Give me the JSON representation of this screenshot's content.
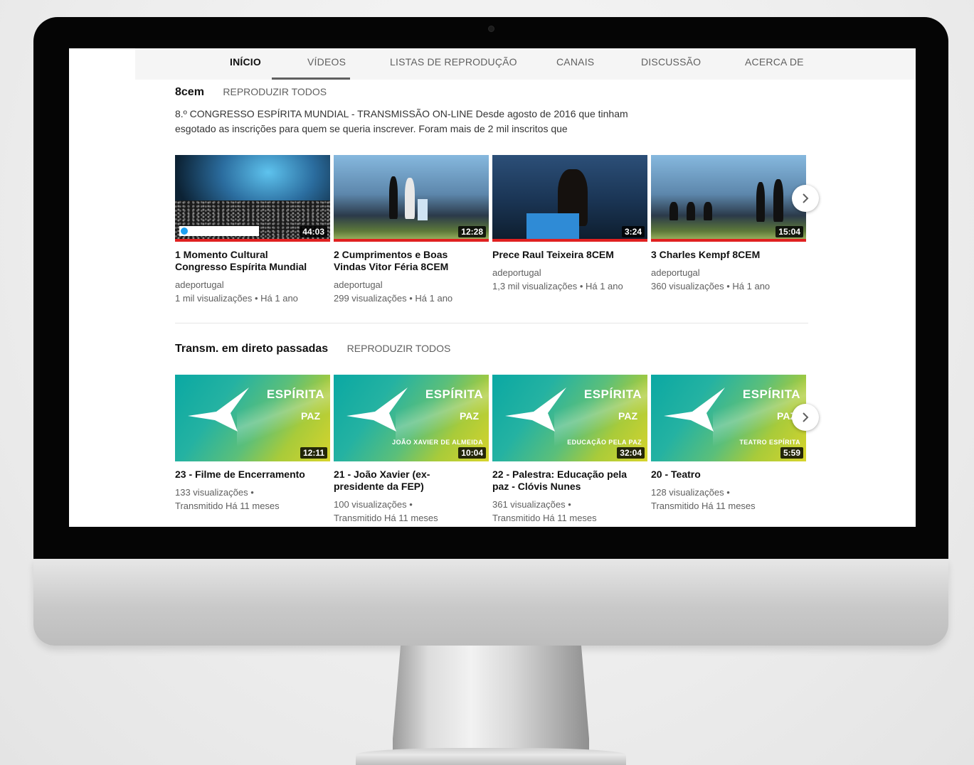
{
  "tabs": [
    {
      "label": "INÍCIO",
      "active": true
    },
    {
      "label": "VÍDEOS",
      "active": false
    },
    {
      "label": "LISTAS DE REPRODUÇÃO",
      "active": false
    },
    {
      "label": "CANAIS",
      "active": false
    },
    {
      "label": "DISCUSSÃO",
      "active": false
    },
    {
      "label": "ACERCA DE",
      "active": false
    }
  ],
  "search_icon": "search-icon",
  "shelf1": {
    "title": "8cem",
    "play_all": "REPRODUZIR TODOS",
    "description_line1": "8.º CONGRESSO ESPÍRITA MUNDIAL - TRANSMISSÃO ON-LINE Desde agosto de 2016 que tinham",
    "description_line2": "esgotado as inscrições para quem se queria inscrever. Foram mais de 2 mil inscritos que",
    "videos": [
      {
        "title_line1": "1 Momento Cultural",
        "title_line2": "Congresso Espírita Mundial",
        "duration": "44:03",
        "channel": "adeportugal",
        "stats": "1 mil visualizações • Há 1 ano"
      },
      {
        "title_line1": "2 Cumprimentos e Boas",
        "title_line2": "Vindas Vitor Féria 8CEM",
        "duration": "12:28",
        "channel": "adeportugal",
        "stats": "299 visualizações • Há 1 ano"
      },
      {
        "title_line1": "Prece Raul Teixeira 8CEM",
        "title_line2": "",
        "duration": "3:24",
        "channel": "adeportugal",
        "stats": "1,3 mil visualizações • Há 1 ano"
      },
      {
        "title_line1": "3 Charles Kempf 8CEM",
        "title_line2": "",
        "duration": "15:04",
        "channel": "adeportugal",
        "stats": "360 visualizações • Há 1 ano"
      }
    ]
  },
  "shelf2": {
    "title": "Transm. em direto passadas",
    "play_all": "REPRODUZIR TODOS",
    "videos": [
      {
        "title_line1": "23 - Filme de Encerramento",
        "title_line2": "",
        "duration": "12:11",
        "views": "133 visualizações •",
        "streamed": "Transmitido Há 11 meses",
        "caption": ""
      },
      {
        "title_line1": "21 - João Xavier (ex-",
        "title_line2": "presidente da FEP)",
        "duration": "10:04",
        "views": "100 visualizações •",
        "streamed": "Transmitido Há 11 meses",
        "caption": "JOÃO XAVIER DE ALMEIDA"
      },
      {
        "title_line1": "22 - Palestra: Educação pela",
        "title_line2": "paz - Clóvis Nunes",
        "duration": "32:04",
        "views": "361 visualizações •",
        "streamed": "Transmitido Há 11 meses",
        "caption": "EDUCAÇÃO PELA PAZ"
      },
      {
        "title_line1": "20 - Teatro",
        "title_line2": "",
        "duration": "5:59",
        "views": "128 visualizações •",
        "streamed": "Transmitido Há 11 meses",
        "caption": "TEATRO ESPÍRITA"
      }
    ],
    "thumb_brand": "ESPÍRITA",
    "thumb_subbrand": "PAZ"
  }
}
